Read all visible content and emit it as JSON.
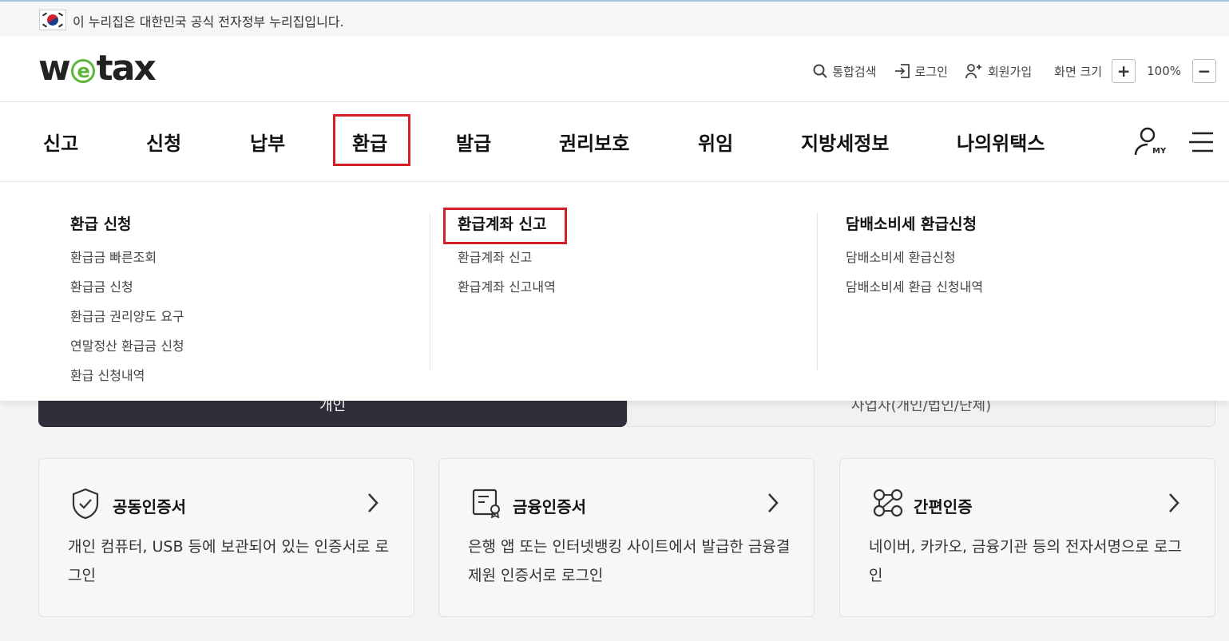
{
  "gov_banner": {
    "text": "이 누리집은 대한민국 공식 전자정부 누리집입니다."
  },
  "header": {
    "logo": {
      "left": "w",
      "middle": "e",
      "right": "tax"
    },
    "utils": {
      "search": "통합검색",
      "login": "로그인",
      "signup": "회원가입",
      "zoom_label": "화면 크기",
      "zoom_in": "+",
      "zoom_value": "100%",
      "zoom_out": "−"
    }
  },
  "gnb": {
    "items": [
      "신고",
      "신청",
      "납부",
      "환급",
      "발급",
      "권리보호",
      "위임",
      "지방세정보",
      "나의위택스"
    ],
    "active": "환급",
    "my_label": "MY"
  },
  "dropdown": {
    "columns": [
      {
        "title": "환급 신청",
        "links": [
          "환급금 빠른조회",
          "환급금 신청",
          "환급금 권리양도 요구",
          "연말정산 환급금 신청",
          "환급 신청내역"
        ]
      },
      {
        "title": "환급계좌 신고",
        "links": [
          "환급계좌 신고",
          "환급계좌 신고내역"
        ]
      },
      {
        "title": "담배소비세 환급신청",
        "links": [
          "담배소비세 환급신청",
          "담배소비세 환급 신청내역"
        ]
      }
    ]
  },
  "tabs": {
    "personal": "개인",
    "business": "사업자(개인/법인/단체)"
  },
  "cards": [
    {
      "title": "공동인증서",
      "desc": "개인 컴퓨터, USB 등에 보관되어 있는 인증서로 로그인",
      "icon": "shield-check-icon"
    },
    {
      "title": "금융인증서",
      "desc": "은행 앱 또는 인터넷뱅킹 사이트에서 발급한 금융결제원 인증서로 로그인",
      "icon": "certificate-icon"
    },
    {
      "title": "간편인증",
      "desc": "네이버, 카카오, 금융기관 등의 전자서명으로 로그인",
      "icon": "network-icon"
    }
  ],
  "colors": {
    "highlight": "#d32026",
    "logo_green": "#5db53a",
    "dark_tab": "#2e2f3a"
  }
}
